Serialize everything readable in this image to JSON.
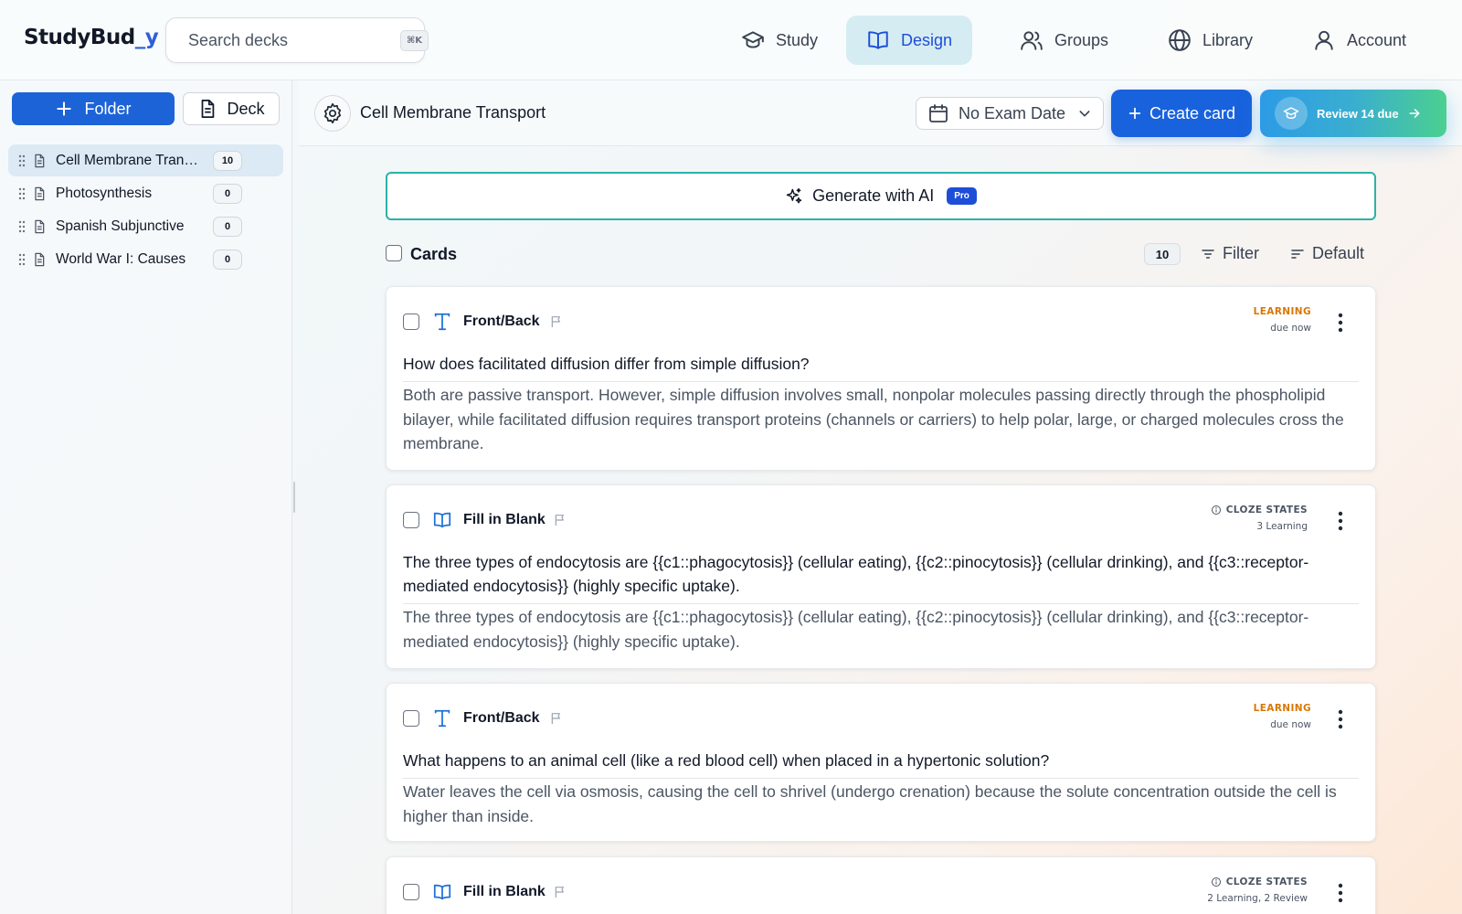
{
  "app": {
    "logo_part1": "StudyBud",
    "logo_part2": "_y"
  },
  "search": {
    "placeholder": "Search decks",
    "shortcut": "⌘K"
  },
  "nav": [
    {
      "label": "Study",
      "icon": "graduation-cap-icon",
      "active": false
    },
    {
      "label": "Design",
      "icon": "open-book-icon",
      "active": true
    },
    {
      "label": "Groups",
      "icon": "users-icon",
      "active": false
    },
    {
      "label": "Library",
      "icon": "globe-icon",
      "active": false
    },
    {
      "label": "Account",
      "icon": "user-icon",
      "active": false
    }
  ],
  "sidebar": {
    "folder_button": "Folder",
    "deck_button": "Deck",
    "decks": [
      {
        "name": "Cell Membrane Transport",
        "count": "10",
        "active": true
      },
      {
        "name": "Photosynthesis",
        "count": "0",
        "active": false
      },
      {
        "name": "Spanish Subjunctive",
        "count": "0",
        "active": false
      },
      {
        "name": "World War I: Causes",
        "count": "0",
        "active": false
      }
    ]
  },
  "toolbar": {
    "deck_title": "Cell Membrane Transport",
    "exam_date": "No Exam Date",
    "create_card": "Create card",
    "review": "Review 14 due"
  },
  "colors": {
    "primary": "#1862dd",
    "accent_teal": "#2bb2a8",
    "learning": "#d97706",
    "active_nav": "#d6ecf3"
  },
  "main": {
    "generate_ai": "Generate with AI",
    "pro_badge": "Pro",
    "cards_label": "Cards",
    "cards_count": "10",
    "filter": "Filter",
    "sort": "Default",
    "cards": [
      {
        "type": "Front/Back",
        "status1": "LEARNING",
        "status2": "due now",
        "front": "How does facilitated diffusion differ from simple diffusion?",
        "back": "Both are passive transport. However, simple diffusion involves small, nonpolar molecules passing directly through the phospholipid bilayer, while facilitated diffusion requires transport proteins (channels or carriers) to help polar, large, or charged molecules cross the membrane."
      },
      {
        "type": "Fill in Blank",
        "status1": "CLOZE STATES",
        "status2": "3 Learning",
        "front": "The three types of endocytosis are {{c1::phagocytosis}} (cellular eating), {{c2::pinocytosis}} (cellular drinking), and {{c3::receptor-mediated endocytosis}} (highly specific uptake).",
        "back": "The three types of endocytosis are {{c1::phagocytosis}} (cellular eating), {{c2::pinocytosis}} (cellular drinking), and {{c3::receptor-mediated endocytosis}} (highly specific uptake)."
      },
      {
        "type": "Front/Back",
        "status1": "LEARNING",
        "status2": "due now",
        "front": "What happens to an animal cell (like a red blood cell) when placed in a hypertonic solution?",
        "back": "Water leaves the cell via osmosis, causing the cell to shrivel (undergo crenation) because the solute concentration outside the cell is higher than inside."
      },
      {
        "type": "Fill in Blank",
        "status1": "CLOZE STATES",
        "status2": "2 Learning, 2 Review",
        "front": "",
        "back": ""
      }
    ]
  }
}
